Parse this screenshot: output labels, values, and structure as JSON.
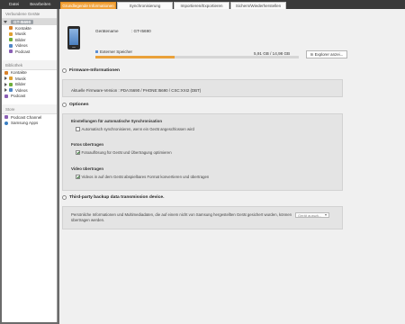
{
  "menu": [
    "Datei",
    "Bearbeiten",
    "Ansicht",
    "Werkzeuge",
    "Hilfe"
  ],
  "sidebar": {
    "connected_title": "Verbundene Geräte",
    "device_name": "GT-I5690",
    "device_items": [
      "Kontakte",
      "Musik",
      "Bilder",
      "Videos",
      "Podcast"
    ],
    "library_title": "Bibliothek",
    "library_items": [
      "Kontakte",
      "Musik",
      "Bilder",
      "Videos",
      "Podcast"
    ],
    "store_title": "Store",
    "store_items": [
      "Podcast Channel",
      "Samsung Apps"
    ]
  },
  "tabs": [
    "Grundlegende Informationen",
    "Synchronisierung",
    "Importieren/Exportieren",
    "Sichern/Wiederherstellen"
  ],
  "device": {
    "model_label": "Gerätename",
    "model_value": ": GT-I5690",
    "storage_label": "Externer Speicher",
    "storage_value": "5,91 GB / 14,98 GB",
    "storage_used_fraction": 0.39,
    "explorer_button": "In Explorer anzei..."
  },
  "firmware": {
    "title": "Firmware-Informationen",
    "text": "Aktuelle Firmware-Version : PDA:I5690 / PHONE:I5690 / CSC:XXI2 (DBT)"
  },
  "options": {
    "title": "Optionen",
    "groups": [
      {
        "title": "Einstellungen für automatische Synchronisation",
        "row": "Automatisch synchronisieren, wenn ein Gerät angeschlossen wird",
        "checked": false
      },
      {
        "title": "Fotos übertragen",
        "row": "Fotoauflösung für Gerät und Übertragung optimieren",
        "checked": true
      },
      {
        "title": "Video übertragen",
        "row": "Videos in auf dem Gerät abspielbares Format konvertieren und übertragen",
        "checked": true
      }
    ]
  },
  "third_party": {
    "title": "Third-party backup data transmission device.",
    "text": "Persönliche Informationen und Multimediadaten, die auf einem nicht von Samsung hergestellten Gerät gesichert wurden, können übertragen werden.",
    "dropdown": "Gerät auswä..."
  },
  "colors": {
    "accent": "#f2a23a",
    "storage_bar": "#e9a13a",
    "sidebar_selected": "#9aa0a6"
  }
}
